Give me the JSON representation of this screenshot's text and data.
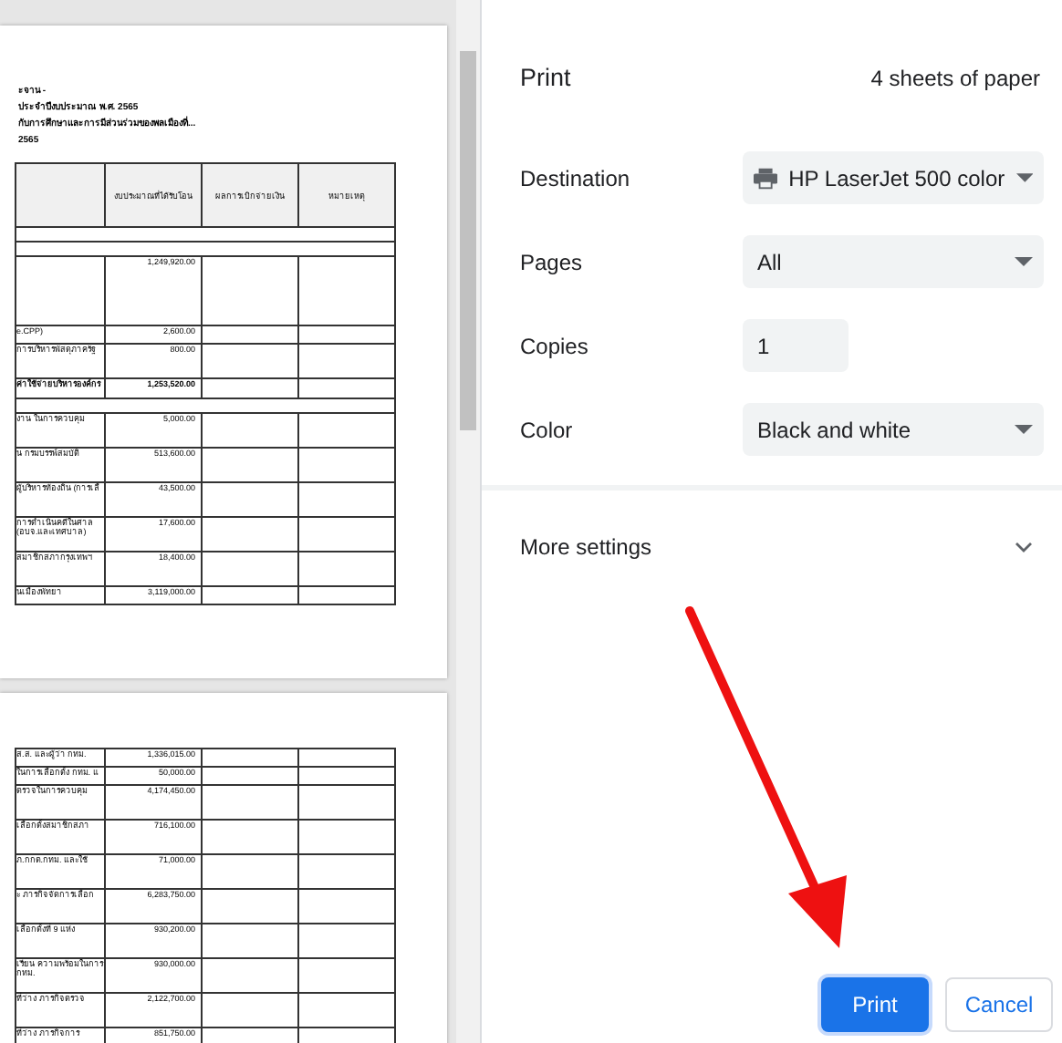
{
  "preview": {
    "pages": [
      {
        "heading": [
          "ะจาน -",
          "ประจำปีงบประมาณ พ.ศ. 2565",
          "กับการศึกษาและการมีส่วนร่วมของพลเมืองที่...",
          "2565"
        ],
        "columns": [
          "",
          "งบประมาณที่ได้รับโอน",
          "ผลการเบิกจ่ายเงิน",
          "หมายเหตุ"
        ],
        "rows": [
          {
            "kind": "section"
          },
          {
            "kind": "section"
          },
          {
            "kind": "block",
            "amount": "1,249,920.00"
          },
          {
            "kind": "line",
            "label": "e.CPP)",
            "amount": "2,600.00"
          },
          {
            "kind": "item",
            "label": "การบริหารพัสดุภาครัฐ",
            "amount": "800.00"
          },
          {
            "kind": "total",
            "label": "ค่าใช้จ่ายบริหารองค์กร",
            "amount": "1,253,520.00"
          },
          {
            "kind": "section"
          },
          {
            "kind": "item",
            "label": "งาน ในการควบคุม",
            "amount": "5,000.00"
          },
          {
            "kind": "item",
            "label": "น กรมบรรพ์สมบัติ",
            "amount": "513,600.00"
          },
          {
            "kind": "item",
            "label": "ผู้บริหารท้องถิ่น (การเลื",
            "amount": "43,500.00"
          },
          {
            "kind": "item",
            "label": "การดำเนินคดีในศาล\n(อบจ.และเทศบาล)",
            "amount": "17,600.00"
          },
          {
            "kind": "item",
            "label": "สมาชิกสภากรุงเทพฯ",
            "amount": "18,400.00"
          },
          {
            "kind": "line",
            "label": "นเมืองพัทยา",
            "amount": "3,119,000.00"
          }
        ]
      },
      {
        "rows": [
          {
            "kind": "line",
            "label": "ส.ส. และผู้ว่า กทม.",
            "amount": "1,336,015.00"
          },
          {
            "kind": "line",
            "label": "ในการเลือกตั้ง กทม. แ",
            "amount": "50,000.00"
          },
          {
            "kind": "item",
            "label": "ตรวจในการควบคุม",
            "amount": "4,174,450.00"
          },
          {
            "kind": "item",
            "label": "เลือกตั้งสมาชิกสภา",
            "amount": "716,100.00"
          },
          {
            "kind": "item",
            "label": "ภ.กกต.กทม. และใช้",
            "amount": "71,000.00"
          },
          {
            "kind": "item",
            "label": "ะ ภารกิจจัดการเลือก",
            "amount": "6,283,750.00"
          },
          {
            "kind": "item",
            "label": "เลือกตั้งที่ 9 แห่ง",
            "amount": "930,200.00"
          },
          {
            "kind": "item",
            "label": "เรียน ความพร้อมในการ\nกทม.",
            "amount": "930,000.00"
          },
          {
            "kind": "item",
            "label": "ที่ว่าง ภารกิจตรวจ",
            "amount": "2,122,700.00"
          },
          {
            "kind": "item",
            "label": "ที่ว่าง ภารกิจการ",
            "amount": "851,750.00"
          }
        ]
      }
    ]
  },
  "settings": {
    "title": "Print",
    "sheets": "4 sheets of paper",
    "fields": [
      {
        "kind": "destination",
        "label": "Destination",
        "value": "HP LaserJet 500 color"
      },
      {
        "kind": "select",
        "label": "Pages",
        "value": "All"
      },
      {
        "kind": "number",
        "label": "Copies",
        "value": "1"
      },
      {
        "kind": "select",
        "label": "Color",
        "value": "Black and white"
      }
    ],
    "more_settings": {
      "label": "More settings",
      "expanded": false
    }
  },
  "buttons": [
    {
      "kind": "primary",
      "label": "Print"
    },
    {
      "kind": "secondary",
      "label": "Cancel"
    }
  ]
}
